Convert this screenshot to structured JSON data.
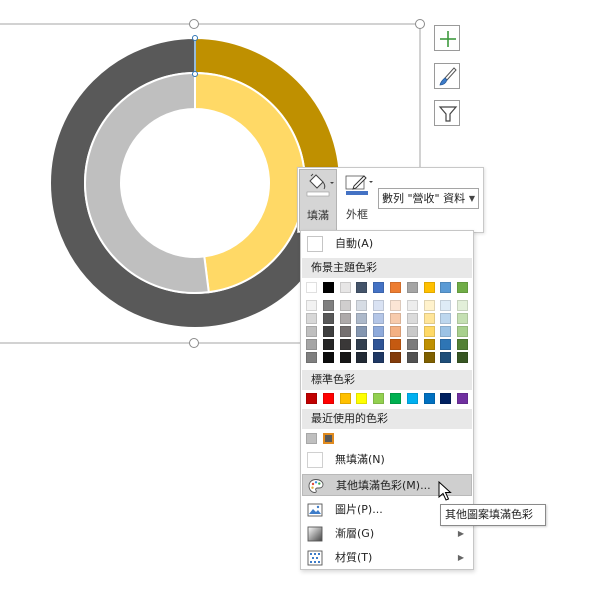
{
  "chart_data": {
    "type": "doughnut",
    "rings": [
      {
        "name": "outer",
        "values": [
          25,
          75
        ],
        "colors": [
          "#BF9000",
          "#595959"
        ]
      },
      {
        "name": "inner",
        "values": [
          48,
          52
        ],
        "colors": [
          "#FFD966",
          "#BFBFBF"
        ]
      }
    ]
  },
  "chart_tools": [
    {
      "name": "add-chart-element",
      "icon": "plus-icon"
    },
    {
      "name": "chart-styles",
      "icon": "brush-icon"
    },
    {
      "name": "chart-filters",
      "icon": "filter-icon"
    }
  ],
  "mini_toolbar": {
    "fill_label": "填滿",
    "outline_label": "外框",
    "series_select": "數列 \"營收\" 資料"
  },
  "menu": {
    "automatic": "自動(A)",
    "theme_colors_header": "佈景主題色彩",
    "standard_colors_header": "標準色彩",
    "recent_colors_header": "最近使用的色彩",
    "no_fill": "無填滿(N)",
    "more_fill_colors": "其他填滿色彩(M)...",
    "picture": "圖片(P)...",
    "gradient": "漸層(G)",
    "texture": "材質(T)"
  },
  "theme_colors": {
    "base": [
      "#FFFFFF",
      "#000000",
      "#E7E6E6",
      "#44546A",
      "#4472C4",
      "#ED7D31",
      "#A5A5A5",
      "#FFC000",
      "#5B9BD5",
      "#70AD47"
    ],
    "tints": [
      [
        "#F2F2F2",
        "#7F7F7F",
        "#D0CECE",
        "#D6DCE4",
        "#D9E2F3",
        "#FBE5D5",
        "#EDEDED",
        "#FFF2CC",
        "#DEEBF6",
        "#E2EFD9"
      ],
      [
        "#D8D8D8",
        "#595959",
        "#AEAAAA",
        "#ADB9CA",
        "#B4C6E7",
        "#F7CBAC",
        "#DBDBDB",
        "#FFE599",
        "#BDD7EE",
        "#C5E0B3"
      ],
      [
        "#BFBFBF",
        "#3F3F3F",
        "#757070",
        "#8496B0",
        "#8EAADB",
        "#F4B183",
        "#C9C9C9",
        "#FFD966",
        "#9CC3E5",
        "#A8D08D"
      ],
      [
        "#A5A5A5",
        "#262626",
        "#3A3838",
        "#323F4F",
        "#2F5496",
        "#C55A11",
        "#7B7B7B",
        "#BF9000",
        "#2E75B5",
        "#538135"
      ],
      [
        "#7F7F7F",
        "#0C0C0C",
        "#171616",
        "#222A35",
        "#1F3864",
        "#833C0B",
        "#525252",
        "#7F6000",
        "#1E4E79",
        "#375623"
      ]
    ]
  },
  "standard_colors": [
    "#C00000",
    "#FF0000",
    "#FFC000",
    "#FFFF00",
    "#92D050",
    "#00B050",
    "#00B0F0",
    "#0070C0",
    "#002060",
    "#7030A0"
  ],
  "recent_colors": [
    "#BFBFBF",
    "#595959"
  ],
  "tooltip": "其他圖案填滿色彩"
}
